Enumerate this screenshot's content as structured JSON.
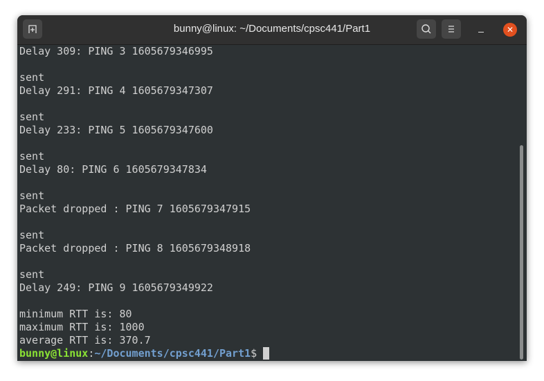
{
  "window": {
    "title": "bunny@linux: ~/Documents/cpsc441/Part1",
    "icons": [
      "new-tab-icon",
      "search-icon",
      "menu-icon",
      "minimize-icon",
      "close-icon"
    ]
  },
  "lines": [
    "Delay 309: PING 3 1605679346995",
    "",
    "sent",
    "Delay 291: PING 4 1605679347307",
    "",
    "sent",
    "Delay 233: PING 5 1605679347600",
    "",
    "sent",
    "Delay 80: PING 6 1605679347834",
    "",
    "sent",
    "Packet dropped : PING 7 1605679347915",
    "",
    "sent",
    "Packet dropped : PING 8 1605679348918",
    "",
    "sent",
    "Delay 249: PING 9 1605679349922",
    "",
    "minimum RTT is: 80",
    "maximum RTT is: 1000",
    "average RTT is: 370.7"
  ],
  "prompt": {
    "user": "bunny@linux",
    "sep": ":",
    "path": "~/Documents/cpsc441/Part1",
    "symbol": "$"
  }
}
